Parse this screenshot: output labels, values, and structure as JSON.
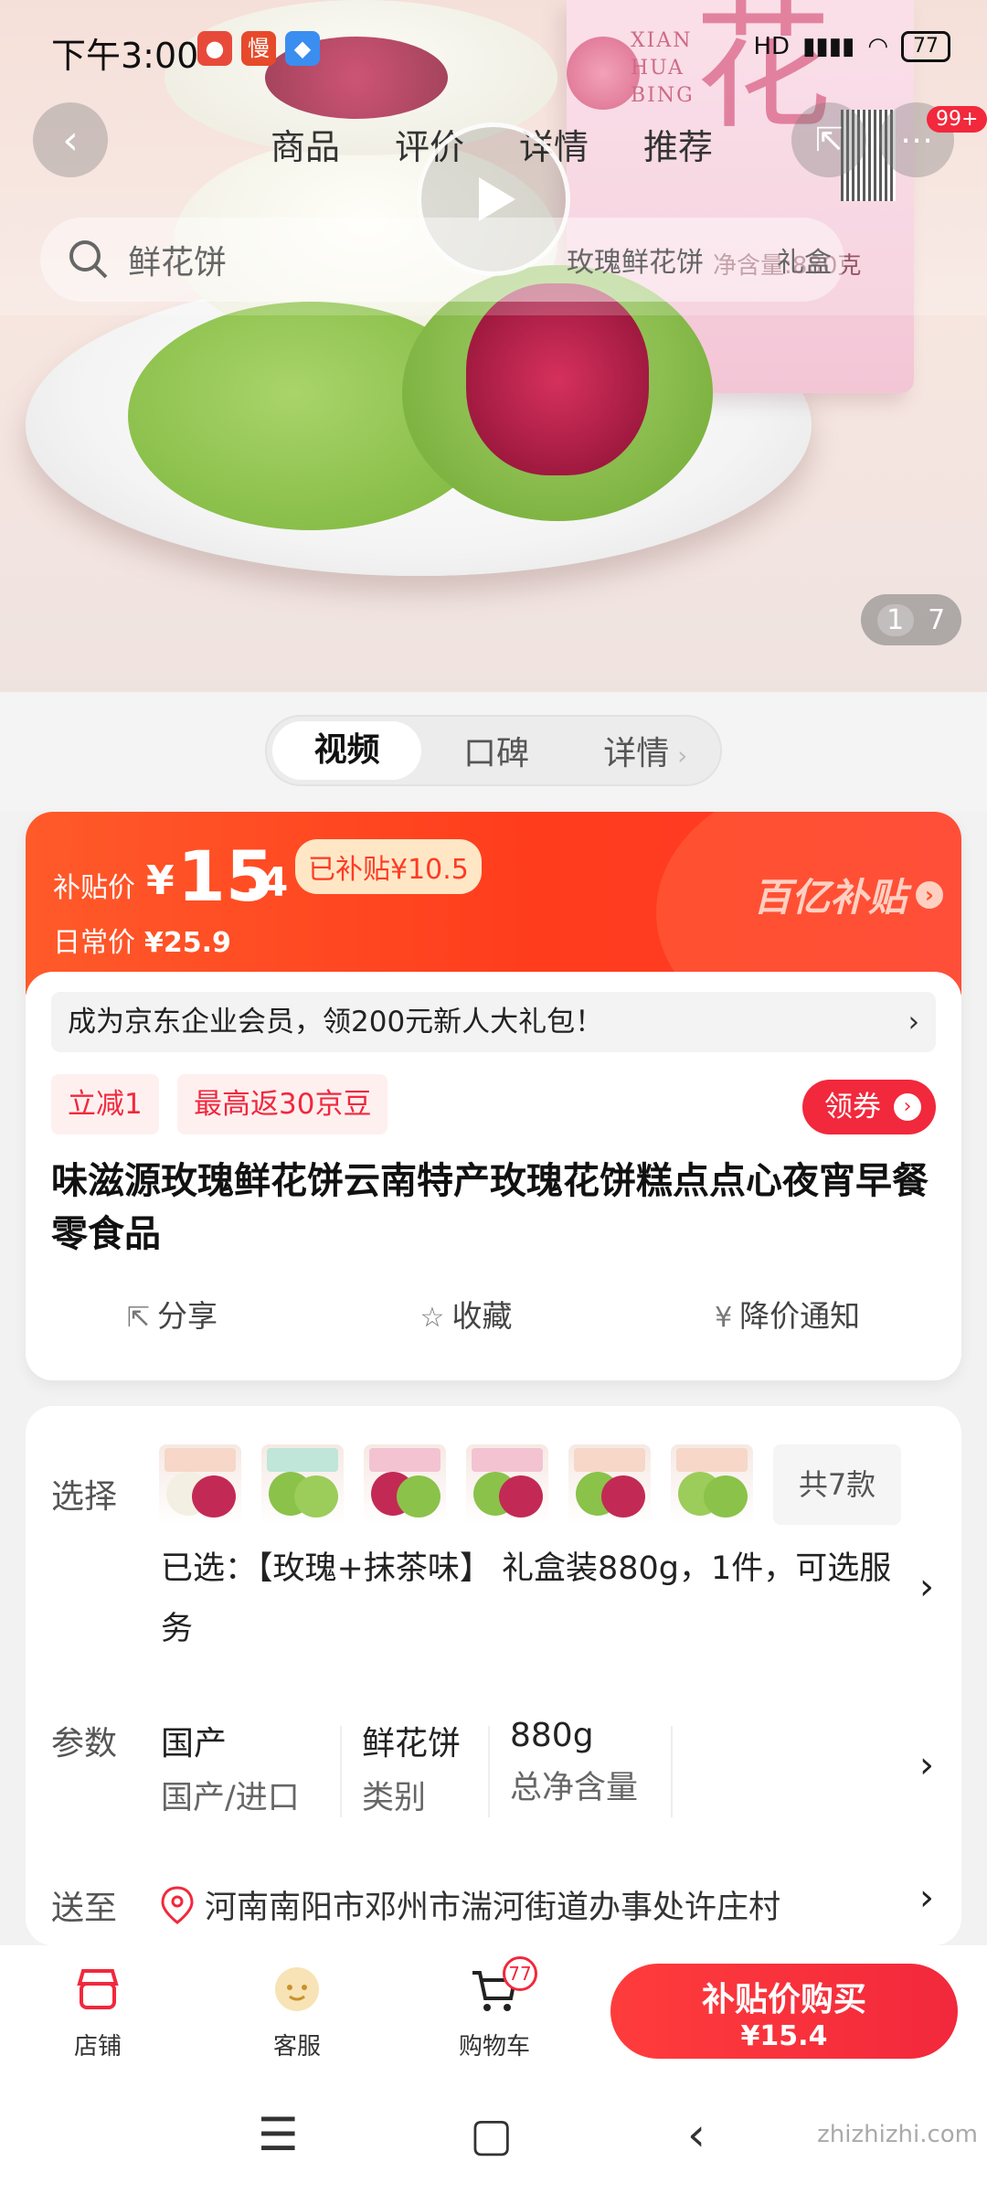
{
  "status_bar": {
    "time": "下午3:00",
    "network": "HD",
    "battery": "77"
  },
  "nav": {
    "tabs": [
      "商品",
      "评价",
      "详情",
      "推荐"
    ],
    "badge": "99+"
  },
  "search": {
    "placeholder": "鲜花饼",
    "hints": [
      "玫瑰鲜花饼",
      "礼盒"
    ]
  },
  "hero_box": {
    "brand_roman": "XIAN HUA BING",
    "big_char": "花",
    "net": "净含量:880克"
  },
  "image_counter": {
    "current": "1",
    "total": "7"
  },
  "segment": {
    "items": [
      "视频",
      "口碑",
      "详情"
    ]
  },
  "price": {
    "label": "补贴价",
    "yen": "¥",
    "int": "15",
    "dec": ".4",
    "subsidy": "已补贴¥10.5",
    "daily_label": "日常价",
    "daily_value": "¥25.9",
    "brand": "百亿补贴"
  },
  "member_banner": "成为京东企业会员，领200元新人大礼包！",
  "tags": [
    "立减1",
    "最高返30京豆"
  ],
  "coupon": "领券",
  "product_title": "味滋源玫瑰鲜花饼云南特产玫瑰花饼糕点点心夜宵早餐零食品",
  "actions": [
    "分享",
    "收藏",
    "降价通知"
  ],
  "select": {
    "label": "选择",
    "more": "共7款",
    "selected_text": "已选：【玫瑰+抹茶味】 礼盒装880g，1件，可选服务"
  },
  "params": {
    "label": "参数",
    "items": [
      {
        "value": "国产",
        "name": "国产/进口"
      },
      {
        "value": "鲜花饼",
        "name": "类别"
      },
      {
        "value": "880g",
        "name": "总净含量"
      }
    ]
  },
  "delivery": {
    "label": "送至",
    "address": "河南南阳市邓州市湍河街道办事处许庄村"
  },
  "bottom": {
    "shop": "店铺",
    "service": "客服",
    "cart": "购物车",
    "cart_count": "77",
    "buy_line1": "补贴价购买",
    "buy_line2": "¥15.4"
  },
  "watermark": "zhizhizhi.com"
}
